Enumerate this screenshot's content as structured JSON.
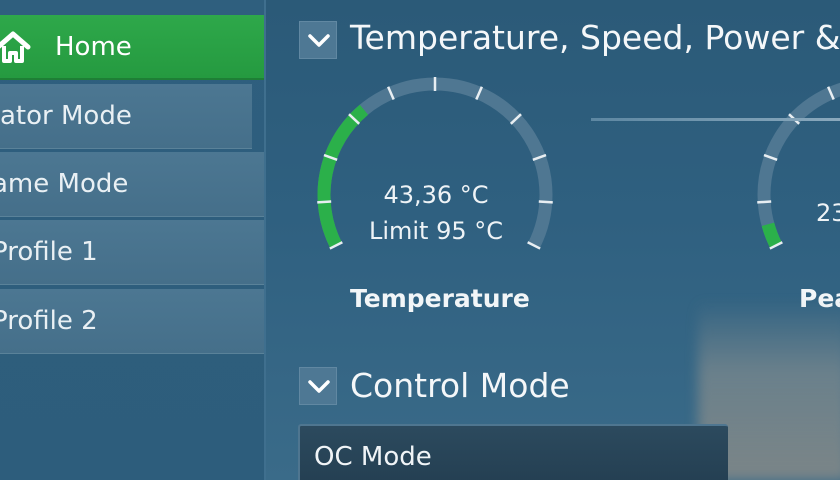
{
  "sidebar": {
    "items": [
      {
        "label": "Home",
        "active": true,
        "icon": "home-icon"
      },
      {
        "label": "eator Mode",
        "active": false
      },
      {
        "label": "ame Mode",
        "active": false
      },
      {
        "label": " Profile 1",
        "active": false
      },
      {
        "label": " Profile 2",
        "active": false
      }
    ]
  },
  "sections": {
    "temperature": {
      "title": "Temperature, Speed, Power &"
    },
    "control": {
      "title": "Control Mode"
    }
  },
  "gauges": [
    {
      "value": "43,36 °C",
      "limit": "Limit 95 °C",
      "name": "Temperature",
      "level": 0.33
    },
    {
      "value": "23",
      "name": "Pea",
      "level": 0.05
    }
  ],
  "control_mode": {
    "selected": "OC Mode"
  },
  "colors": {
    "accent": "#2ea84a",
    "gauge_track": "#4f7792",
    "gauge_fill": "#2bb04a",
    "background": "#2f6080"
  }
}
